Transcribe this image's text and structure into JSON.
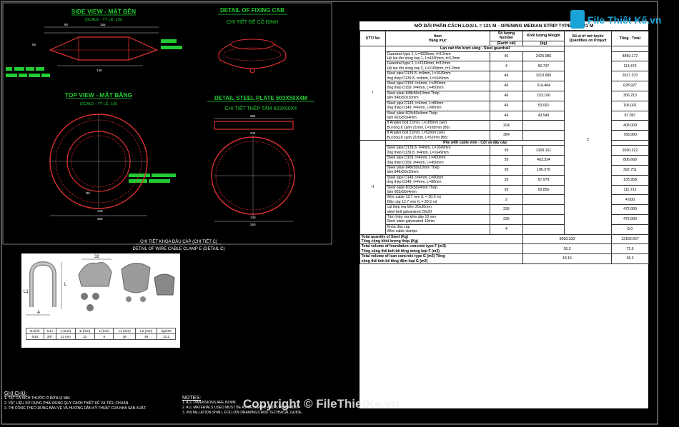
{
  "drawings": {
    "side_view": {
      "title": "SIDE VIEW - MẶT BÊN",
      "scale": "(SCALE - TỶ LỆ: 1/5)",
      "dims": [
        "80",
        "165",
        "50",
        "140"
      ]
    },
    "fixing_cab": {
      "title": "DETAIL OF FIXING CAB",
      "subtitle": "CHI TIẾT ĐẾ CỐ ĐỊNH"
    },
    "top_view": {
      "title": "TOP VIEW - MẶT BẰNG",
      "scale": "(SCALE - TỶ LỆ: 1/5)",
      "dims": [
        "256",
        "140",
        "R5"
      ]
    },
    "steel_plate": {
      "title": "DETAIL STEEL PLATE 603X50X4M",
      "subtitle": "CHI TIẾT THÉP TẤM 603X50X4",
      "dims": [
        "254",
        "244",
        "250",
        "140"
      ]
    },
    "wire_clamp": {
      "title": "CHI TIẾT KHÓA ĐẦU CÁP (CHI TIẾT C)",
      "subtitle": "DETAIL OF WIRE CABLE CLAMP E (DETAIL C)"
    }
  },
  "photo": {
    "dim_labels": [
      "A",
      "L1",
      "L",
      "32"
    ],
    "table_header": [
      "Đ.kính",
      "S.Lt",
      "A (mm)",
      "E (mm)",
      "L (mm)",
      "L1 (mm)",
      "L2 (mm)",
      "kg/100"
    ],
    "table_row": [
      "Φ10",
      "3/8\"",
      "12 mm",
      "22",
      "9",
      "36",
      "49",
      "23.2"
    ]
  },
  "table": {
    "title": "MỞ DẢI PHÂN CÁCH LOẠI L = 121 M - OPENING MEDIAN STRIP TYPE L = 121 M",
    "headers": {
      "stt": "STT/ No",
      "item": "Item\nHạng mục",
      "num": "Số lượng Number",
      "num_unit": "(Each/ cái)",
      "weight": "Khối lượng Weight",
      "weight_unit": "(kg)",
      "qty": "Số vị trí mở tuyến Quantities on Project",
      "total": "Tổng - Total"
    },
    "sections": [
      {
        "stt": "I",
        "title": "Lan can tôn lượn sóng - Steel guardrail",
        "rows": [
          {
            "item": [
              "Guardrail type 1, L=4330mm, t=3.2mm",
              "Hộ lan tôn sóng loại 1, L=4330mm, t=3.2mm"
            ],
            "num": "46",
            "weight": "2425.086",
            "total": "4850.172"
          },
          {
            "item": [
              "Guardrail type 2, L=1169mm, t=3.2mm",
              "Hộ lan tôn sóng loại 2, L=1169mm, t=3.2mm"
            ],
            "num": "4",
            "weight": "56.737",
            "total": "113.474"
          },
          {
            "item": [
              "Steel pipe D139.8, t=4mm, L=1649mm",
              "ống thép D139.8, t=4mm, L=1649mm"
            ],
            "num": "46",
            "weight": "1013.685",
            "total": "2027.370"
          },
          {
            "item": [
              "Steel pipe D159, t=4mm, L=450mm",
              "ống thép D159, t=4mm, L=450mm"
            ],
            "num": "46",
            "weight": "314.464",
            "total": "628.927"
          },
          {
            "item": [
              "Steel plate 848x50x10mm                Thép",
              "tấm 848x50x10mm"
            ],
            "num": "46",
            "weight": "153.106",
            "total": "306.213"
          },
          {
            "item": [
              "Steel pipe D149, t=4mm, L=80mm",
              "ống thép D149, t=4mm, L=80mm"
            ],
            "num": "46",
            "weight": "53.001",
            "total": "106.001"
          },
          {
            "item": [
              "Steel plate 603x50x4mm                 Thép",
              "tấm 603x50x4mm"
            ],
            "num": "46",
            "weight": "43.549",
            "total": "87.097"
          },
          {
            "item": [
              "8 Angles bolt 21mm, L=165mm (set)",
              "Bu lông 8 cạnh 21mm, L=165mm (Bộ)"
            ],
            "num": "204",
            "weight": "",
            "total": "408.000"
          },
          {
            "item": [
              "8 Angles bolt 21mm, L=52mm (set)",
              "Bu lông 8 cạnh 21mm, L=52mm (Bộ)"
            ],
            "num": "384",
            "weight": "",
            "total": "768.000"
          }
        ]
      },
      {
        "stt": "II",
        "title": "Pile with cable wire - Cột và dây cáp",
        "rows": [
          {
            "item": [
              "Steel pipe D139.8, t=4mm, L=1649mm",
              "ống thép D139.8, t=4mm, L=1649mm"
            ],
            "num": "59",
            "weight": "1300.161",
            "total": "2600.322"
          },
          {
            "item": [
              "Steel pipe D159, t=4mm, L=450mm",
              "ống thép D159, t=4mm, L=450mm"
            ],
            "num": "59",
            "weight": "403.334",
            "total": "806.668"
          },
          {
            "item": [
              "Steel plate 848x50x10mm                Thép",
              "tấm 848x50x10mm"
            ],
            "num": "59",
            "weight": "196.376",
            "total": "392.751"
          },
          {
            "item": [
              "Steel pipe D149, t=4mm, L=80mm",
              "ống thép D149, t=4mm, L=80mm"
            ],
            "num": "59",
            "weight": "67.979",
            "total": "135.958"
          },
          {
            "item": [
              "Steel plate 603x50x4mm                 Thép",
              "tấm 603x50x4mm"
            ],
            "num": "59",
            "weight": "55.856",
            "total": "111.712"
          },
          {
            "item": [
              "Wire cable 12.7 mm (L = 30.5 m)",
              "Dây cáp 12.7 mm (L = 30.5 m)"
            ],
            "num": "2",
            "weight": "",
            "total": "4.000"
          },
          {
            "item": [
              "cái thép mạ kẽm 20x20mm",
              "steel belt galvanized 20x20"
            ],
            "num": "236",
            "weight": "",
            "total": "472.000"
          },
          {
            "item": [
              "Tấm thép mạ kẽm dày 10 mm",
              "Steel plate galvanized 10mm"
            ],
            "num": "236",
            "weight": "",
            "total": "472.000"
          },
          {
            "item": [
              "Khóa đầu cáp",
              "Wire cable clamps"
            ],
            "num": "4",
            "weight": "",
            "total": "8.0"
          }
        ]
      }
    ],
    "qty_value": "2",
    "summary": [
      {
        "label": [
          "Total quantity of Steel (Kg)",
          "Tổng cộng khối lượng thép (Kg)"
        ],
        "weight": "6083.333",
        "total": "12166.667"
      },
      {
        "label": [
          "Total volume of foundation concrete type F (m3)",
          "Tổng cộng thể tích bê tông móng loại F (m3)"
        ],
        "weight": "36.3",
        "total": "72.6"
      },
      {
        "label": [
          "Total volume of lean concrete type G (m3)                Tổng",
          "cộng thể tích bê tông đệm loại G (m3)"
        ],
        "weight": "18.15",
        "total": "36.3"
      }
    ]
  },
  "notes_left": {
    "title": "GHI CHÚ:",
    "lines": [
      "1. TẤT CẢ KÍCH THƯỚC Ở ĐƠN VỊ MM.",
      "2. VẬT LIỆU SỬ DỤNG PHẢI ĐÚNG QUY CÁCH THIẾT KẾ VÀ TIÊU CHUẨN.",
      "3. THI CÔNG THEO ĐÚNG BẢN VẼ VÀ HƯỚNG DẪN KỸ THUẬT CỦA NHÀ SẢN XUẤT."
    ]
  },
  "notes_right": {
    "title": "NOTES:",
    "lines": [
      "1. ALL DIMENSIONS ARE IN MM.",
      "2. ALL MATERIALS USED MUST BE AS DESIGNED AND STANDARDS.",
      "3. INSTALLATION SHALL FOLLOW DRAWINGS AND TECHNICAL GUIDE."
    ]
  },
  "brand": {
    "logo": "File Thiết Kế.vn",
    "watermark": "Copyright © FileThietKe.vn"
  },
  "colors": {
    "line_red": "#e03030",
    "label_green": "#22cc33",
    "dim_white": "#ffffff",
    "frame": "#ffffff"
  }
}
